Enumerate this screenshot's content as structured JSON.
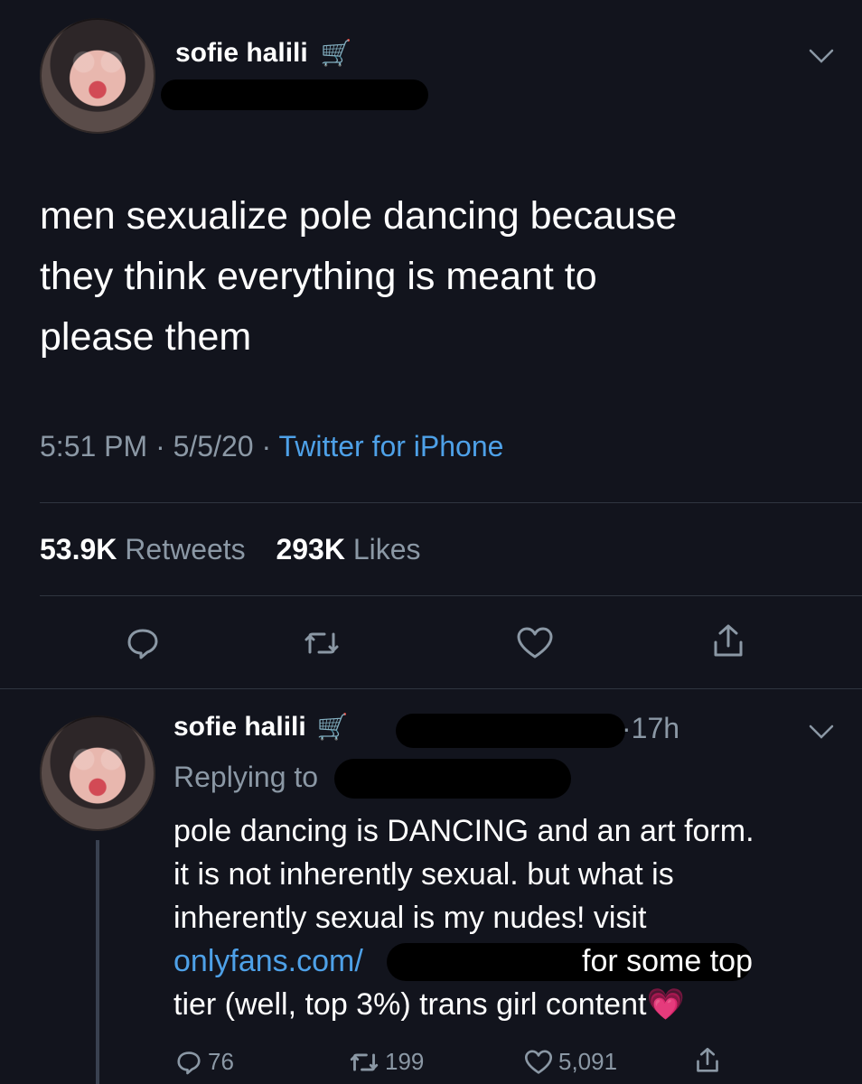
{
  "tweet": {
    "author_name": "sofie halili",
    "name_emoji": "🛒",
    "text_lines": [
      "men sexualize pole dancing because",
      "they think everything is meant to",
      "please them"
    ],
    "time": "5:51 PM",
    "date": "5/5/20",
    "source": "Twitter for iPhone",
    "retweets_count": "53.9K",
    "retweets_label": "Retweets",
    "likes_count": "293K",
    "likes_label": "Likes"
  },
  "reply": {
    "author_name": "sofie halili",
    "name_emoji": "🛒",
    "time": "17h",
    "replying_label": "Replying to",
    "lines": [
      "pole dancing is DANCING and an art form.",
      "it is not inherently sexual. but what is",
      "inherently sexual is my nudes! visit"
    ],
    "link_text": "onlyfans.com/",
    "after_link": "for some top",
    "last_line": "tier (well, top 3%) trans girl content",
    "heart_emoji": "💗",
    "stats": {
      "replies": "76",
      "retweets": "199",
      "likes": "5,091"
    }
  },
  "icons": {
    "more": "chevron-down-icon",
    "reply": "comment-icon",
    "retweet": "retweet-icon",
    "like": "heart-icon",
    "share": "share-icon"
  },
  "colors": {
    "background": "#12141d",
    "secondary_text": "#8b98a5",
    "link": "#4ea1e8",
    "divider": "#2f3540"
  }
}
